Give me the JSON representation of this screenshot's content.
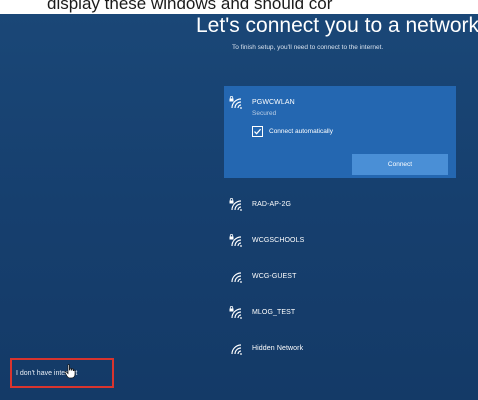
{
  "caption": "display these windows and should cor",
  "heading": "Let's connect you to a network",
  "subtitle": "To finish setup, you'll need to connect to the internet.",
  "selected_network": {
    "name": "PGWCWLAN",
    "status": "Secured",
    "connect_automatically_label": "Connect automatically",
    "connect_automatically_checked": true,
    "connect_button": "Connect"
  },
  "networks": [
    {
      "name": "RAD-AP-2G",
      "secured": true
    },
    {
      "name": "WCGSCHOOLS",
      "secured": true
    },
    {
      "name": "WCG-GUEST",
      "secured": false
    },
    {
      "name": "MLOG_TEST",
      "secured": true
    },
    {
      "name": "Hidden Network",
      "secured": false
    }
  ],
  "no_internet_link": "I don't have internet",
  "icons": {
    "wifi": "wifi-signal-icon",
    "lock": "lock-icon",
    "check": "checkmark-icon",
    "cursor": "hand-cursor-icon"
  },
  "colors": {
    "background": "#163e6c",
    "selected_row": "#2467b1",
    "button": "#4a8fd6",
    "highlight_box": "#d8342e"
  }
}
